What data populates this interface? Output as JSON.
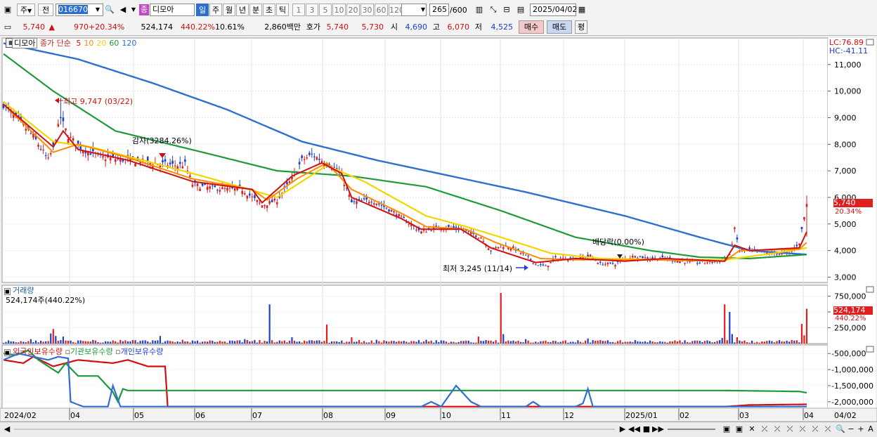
{
  "toolbar": {
    "market": "주",
    "prev": "전",
    "code": "016670",
    "type_badge": "종",
    "name": "디모아",
    "periods": [
      "일",
      "주",
      "월",
      "년",
      "분",
      "초",
      "틱"
    ],
    "active_period": "일",
    "minutes": [
      "1",
      "3",
      "5",
      "10",
      "20",
      "30",
      "60",
      "120"
    ],
    "count": "265",
    "count_max": "/600",
    "date": "2025/04/02"
  },
  "quote": {
    "price": "5,740",
    "change_arrow": "▲",
    "change": "970",
    "change_pct": "+20.34%",
    "volume": "524,174",
    "volume_ratio": "440.22%",
    "turnover": "10.61%",
    "amount": "2,860백만",
    "bid_label": "호가",
    "ask": "5,740",
    "bid": "5,730",
    "open_label": "시",
    "open": "4,690",
    "high_label": "고",
    "high": "6,070",
    "low_label": "저",
    "low": "4,525",
    "buy_label": "매수",
    "sell_label": "매도",
    "eval_label": "평"
  },
  "legend": {
    "name": "디모아",
    "label": "종가 단순",
    "mas": [
      {
        "p": "5",
        "color": "#d01010"
      },
      {
        "p": "10",
        "color": "#ff8c00"
      },
      {
        "p": "20",
        "color": "#f2d600"
      },
      {
        "p": "60",
        "color": "#1e9a3a"
      },
      {
        "p": "120",
        "color": "#2f6fd0"
      }
    ]
  },
  "price_panel": {
    "lc": "LC:76.89",
    "hc": "HC:-41.11",
    "last_price": "5,740",
    "last_pct": "20.34%",
    "annot_high": "최고 9,747 (03/22)",
    "annot_gap": "감자(3284.26%)",
    "annot_div": "배당락(0.00%)",
    "annot_low": "최저 3,245 (11/14)"
  },
  "volume_panel": {
    "title": "거래량",
    "value": "524,174주(440.22%)",
    "last": "524,174",
    "last_pct": "440.22%"
  },
  "holding_panel": {
    "t1": "외국인보유수량",
    "t2": "기관보유수량",
    "t3": "개인보유수량"
  },
  "chart_data": [
    {
      "type": "candlestick",
      "ylim": [
        2800,
        12000
      ],
      "yticks": [
        "11,000",
        "10,000",
        "9,000",
        "8,000",
        "7,000",
        "6,000",
        "5,000",
        "4,000",
        "3,000"
      ],
      "ytick_values": [
        11000,
        10000,
        9000,
        8000,
        7000,
        6000,
        5000,
        4000,
        3000
      ],
      "x_labels": [
        "2024/02",
        "04",
        "05",
        "06",
        "07",
        "08",
        "09",
        "10",
        "11",
        "12",
        "2025/01",
        "02",
        "03",
        "04",
        "04/02"
      ],
      "close_keyframes": [
        [
          0,
          9500
        ],
        [
          5,
          9000
        ],
        [
          12,
          8300
        ],
        [
          18,
          7400
        ],
        [
          20,
          7900
        ],
        [
          23,
          9000
        ],
        [
          26,
          8300
        ],
        [
          32,
          7800
        ],
        [
          40,
          7500
        ],
        [
          50,
          7400
        ],
        [
          60,
          7300
        ],
        [
          70,
          7200
        ],
        [
          73,
          7250
        ],
        [
          76,
          6500
        ],
        [
          80,
          6400
        ],
        [
          90,
          6300
        ],
        [
          96,
          6300
        ],
        [
          104,
          5700
        ],
        [
          110,
          5900
        ],
        [
          116,
          6700
        ],
        [
          120,
          7400
        ],
        [
          124,
          7600
        ],
        [
          128,
          7400
        ],
        [
          132,
          7200
        ],
        [
          136,
          6800
        ],
        [
          140,
          5800
        ],
        [
          148,
          5900
        ],
        [
          156,
          5500
        ],
        [
          162,
          5100
        ],
        [
          168,
          4700
        ],
        [
          176,
          4900
        ],
        [
          184,
          4800
        ],
        [
          192,
          4500
        ],
        [
          196,
          4000
        ],
        [
          200,
          4200
        ],
        [
          205,
          4100
        ],
        [
          210,
          3800
        ],
        [
          214,
          3500
        ],
        [
          218,
          3400
        ],
        [
          222,
          3700
        ],
        [
          230,
          3700
        ],
        [
          236,
          3800
        ],
        [
          240,
          3500
        ],
        [
          246,
          3500
        ],
        [
          250,
          3700
        ],
        [
          254,
          3800
        ],
        [
          260,
          3700
        ],
        [
          266,
          3700
        ],
        [
          272,
          3600
        ],
        [
          280,
          3550
        ],
        [
          288,
          3600
        ],
        [
          292,
          3800
        ],
        [
          294,
          4800
        ],
        [
          296,
          4000
        ],
        [
          300,
          4000
        ],
        [
          308,
          3900
        ],
        [
          316,
          3900
        ],
        [
          320,
          4300
        ],
        [
          323,
          5740
        ]
      ],
      "high": 9747,
      "low": 3245,
      "last": 5740,
      "ma5": [
        [
          0,
          9500
        ],
        [
          20,
          7900
        ],
        [
          24,
          8500
        ],
        [
          30,
          7800
        ],
        [
          50,
          7400
        ],
        [
          76,
          6600
        ],
        [
          100,
          6300
        ],
        [
          104,
          5800
        ],
        [
          116,
          6800
        ],
        [
          128,
          7300
        ],
        [
          136,
          6900
        ],
        [
          140,
          6000
        ],
        [
          160,
          5200
        ],
        [
          168,
          4800
        ],
        [
          184,
          4800
        ],
        [
          196,
          4100
        ],
        [
          214,
          3550
        ],
        [
          230,
          3700
        ],
        [
          250,
          3600
        ],
        [
          266,
          3700
        ],
        [
          290,
          3600
        ],
        [
          294,
          4200
        ],
        [
          300,
          4000
        ],
        [
          320,
          4100
        ],
        [
          323,
          4700
        ]
      ],
      "ma10": [
        [
          0,
          9500
        ],
        [
          20,
          7700
        ],
        [
          30,
          8000
        ],
        [
          50,
          7500
        ],
        [
          76,
          6700
        ],
        [
          100,
          6300
        ],
        [
          106,
          5900
        ],
        [
          118,
          6700
        ],
        [
          130,
          7300
        ],
        [
          140,
          6300
        ],
        [
          160,
          5400
        ],
        [
          170,
          4900
        ],
        [
          186,
          4800
        ],
        [
          198,
          4300
        ],
        [
          216,
          3700
        ],
        [
          232,
          3650
        ],
        [
          262,
          3650
        ],
        [
          290,
          3600
        ],
        [
          296,
          4000
        ],
        [
          320,
          4050
        ],
        [
          323,
          4300
        ]
      ],
      "ma20": [
        [
          0,
          9600
        ],
        [
          20,
          8100
        ],
        [
          35,
          7900
        ],
        [
          60,
          7300
        ],
        [
          80,
          6800
        ],
        [
          110,
          6000
        ],
        [
          130,
          7200
        ],
        [
          145,
          6600
        ],
        [
          170,
          5300
        ],
        [
          186,
          4900
        ],
        [
          200,
          4500
        ],
        [
          220,
          3900
        ],
        [
          240,
          3700
        ],
        [
          270,
          3650
        ],
        [
          290,
          3650
        ],
        [
          310,
          3900
        ],
        [
          323,
          4100
        ]
      ],
      "ma60": [
        [
          0,
          11400
        ],
        [
          20,
          10000
        ],
        [
          45,
          8500
        ],
        [
          80,
          7700
        ],
        [
          110,
          7000
        ],
        [
          140,
          6800
        ],
        [
          170,
          6400
        ],
        [
          200,
          5500
        ],
        [
          230,
          4500
        ],
        [
          260,
          4000
        ],
        [
          280,
          3750
        ],
        [
          300,
          3700
        ],
        [
          323,
          3850
        ]
      ],
      "ma120": [
        [
          0,
          11800
        ],
        [
          30,
          11200
        ],
        [
          60,
          10300
        ],
        [
          90,
          9300
        ],
        [
          120,
          8100
        ],
        [
          150,
          7400
        ],
        [
          180,
          6800
        ],
        [
          210,
          6200
        ],
        [
          250,
          5300
        ],
        [
          280,
          4500
        ],
        [
          300,
          4000
        ],
        [
          323,
          3850
        ]
      ]
    },
    {
      "type": "bar",
      "ylim": [
        0,
        900000
      ],
      "yticks": [
        "750,000",
        "500,000",
        "250,000"
      ],
      "ytick_values": [
        750000,
        500000,
        250000
      ],
      "spikes": [
        [
          11,
          70000
        ],
        [
          19,
          160000
        ],
        [
          20,
          230000
        ],
        [
          21,
          120000
        ],
        [
          24,
          110000
        ],
        [
          44,
          50000
        ],
        [
          63,
          120000
        ],
        [
          72,
          60000
        ],
        [
          97,
          70000
        ],
        [
          107,
          620000
        ],
        [
          116,
          100000
        ],
        [
          130,
          300000
        ],
        [
          140,
          100000
        ],
        [
          150,
          60000
        ],
        [
          170,
          60000
        ],
        [
          191,
          110000
        ],
        [
          200,
          800000
        ],
        [
          201,
          150000
        ],
        [
          210,
          70000
        ],
        [
          235,
          80000
        ],
        [
          289,
          90000
        ],
        [
          290,
          620000
        ],
        [
          292,
          500000
        ],
        [
          293,
          150000
        ],
        [
          295,
          100000
        ],
        [
          321,
          310000
        ],
        [
          322,
          130000
        ],
        [
          323,
          550000
        ]
      ]
    },
    {
      "type": "line",
      "ylim": [
        -2200000,
        -300000
      ],
      "yticks": [
        "-500,000",
        "-1,000,000",
        "-1,500,000",
        "-2,000,000"
      ],
      "ytick_values": [
        -500000,
        -1000000,
        -1500000,
        -2000000
      ],
      "series": [
        {
          "name": "외국인보유수량",
          "color": "#d01010",
          "points": [
            [
              0,
              -700000
            ],
            [
              8,
              -800000
            ],
            [
              12,
              -600000
            ],
            [
              20,
              -900000
            ],
            [
              30,
              -700000
            ],
            [
              44,
              -800000
            ],
            [
              50,
              -700000
            ],
            [
              58,
              -900000
            ],
            [
              65,
              -900000
            ],
            [
              66,
              -2150000
            ],
            [
              120,
              -2150000
            ],
            [
              200,
              -2150000
            ],
            [
              290,
              -2150000
            ],
            [
              300,
              -2100000
            ],
            [
              323,
              -2080000
            ]
          ]
        },
        {
          "name": "기관보유수량",
          "color": "#1e9a3a",
          "points": [
            [
              0,
              -500000
            ],
            [
              5,
              -550000
            ],
            [
              10,
              -400000
            ],
            [
              14,
              -700000
            ],
            [
              18,
              -900000
            ],
            [
              22,
              -1100000
            ],
            [
              25,
              -800000
            ],
            [
              30,
              -1200000
            ],
            [
              38,
              -1200000
            ],
            [
              44,
              -1700000
            ],
            [
              46,
              -2000000
            ],
            [
              48,
              -1600000
            ],
            [
              50,
              -1650000
            ],
            [
              100,
              -1650000
            ],
            [
              200,
              -1650000
            ],
            [
              290,
              -1650000
            ],
            [
              320,
              -1680000
            ],
            [
              323,
              -1720000
            ]
          ]
        },
        {
          "name": "개인보유수량",
          "color": "#2f6fd0",
          "points": [
            [
              0,
              -700000
            ],
            [
              6,
              -500000
            ],
            [
              12,
              -600000
            ],
            [
              18,
              -700000
            ],
            [
              22,
              -600000
            ],
            [
              26,
              -650000
            ],
            [
              27,
              -2000000
            ],
            [
              32,
              -2150000
            ],
            [
              42,
              -2150000
            ],
            [
              44,
              -1500000
            ],
            [
              47,
              -2150000
            ],
            [
              120,
              -2150000
            ],
            [
              168,
              -2150000
            ],
            [
              172,
              -2000000
            ],
            [
              176,
              -2150000
            ],
            [
              182,
              -1500000
            ],
            [
              188,
              -2000000
            ],
            [
              192,
              -2150000
            ],
            [
              210,
              -2150000
            ],
            [
              213,
              -2000000
            ],
            [
              216,
              -2150000
            ],
            [
              230,
              -2150000
            ],
            [
              233,
              -2050000
            ],
            [
              235,
              -1600000
            ],
            [
              237,
              -2150000
            ],
            [
              300,
              -2150000
            ],
            [
              323,
              -2150000
            ]
          ]
        }
      ]
    }
  ]
}
